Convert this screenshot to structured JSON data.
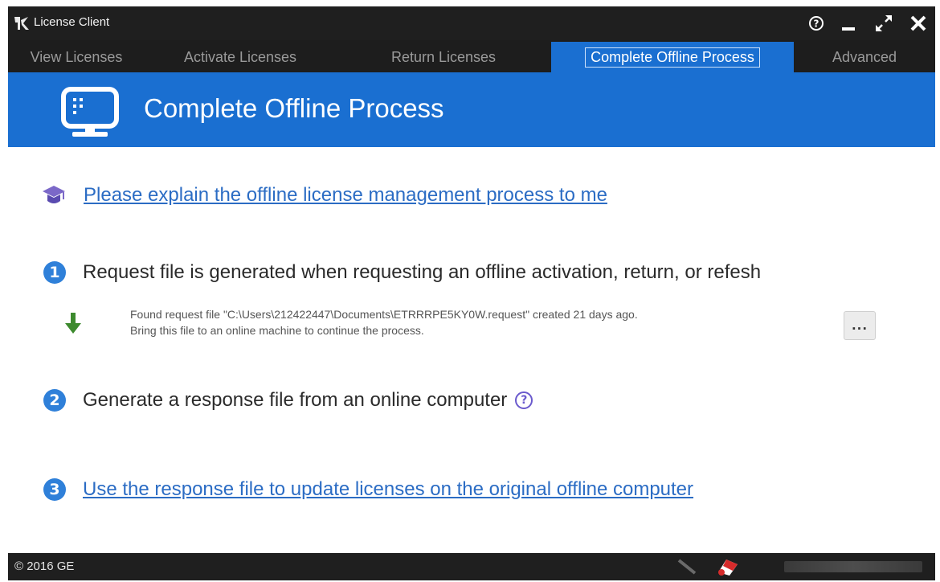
{
  "titlebar": {
    "title": "License Client",
    "controls": [
      "help-icon",
      "minimize-icon",
      "maximize-icon",
      "close-icon"
    ]
  },
  "tabs": [
    {
      "label": "View Licenses",
      "active": false
    },
    {
      "label": "Activate Licenses",
      "active": false
    },
    {
      "label": "Return Licenses",
      "active": false
    },
    {
      "label": "Complete Offline Process",
      "active": true
    },
    {
      "label": "Advanced",
      "active": false
    }
  ],
  "banner": {
    "title": "Complete Offline Process",
    "icon": "monitor-icon"
  },
  "content": {
    "explain_link": "Please explain the offline license management process to me",
    "step1": {
      "number": "1",
      "text": "Request file is generated when requesting an offline activation, return, or refesh",
      "found_line1": "Found request file \"C:\\Users\\212422447\\Documents\\ETRRRPE5KY0W.request\" created 21 days ago.",
      "found_line2": "Bring this file to an online machine to continue the process.",
      "more_button": "..."
    },
    "step2": {
      "number": "2",
      "text": "Generate a response file from an online computer",
      "help": "?"
    },
    "step3": {
      "number": "3",
      "link": "Use the response file to update licenses on the original offline computer"
    }
  },
  "statusbar": {
    "copyright": "© 2016 GE"
  },
  "colors": {
    "accent": "#1a6fd1",
    "link": "#2b6cc4",
    "badge": "#2f80d9",
    "arrow": "#3d8a2e"
  }
}
